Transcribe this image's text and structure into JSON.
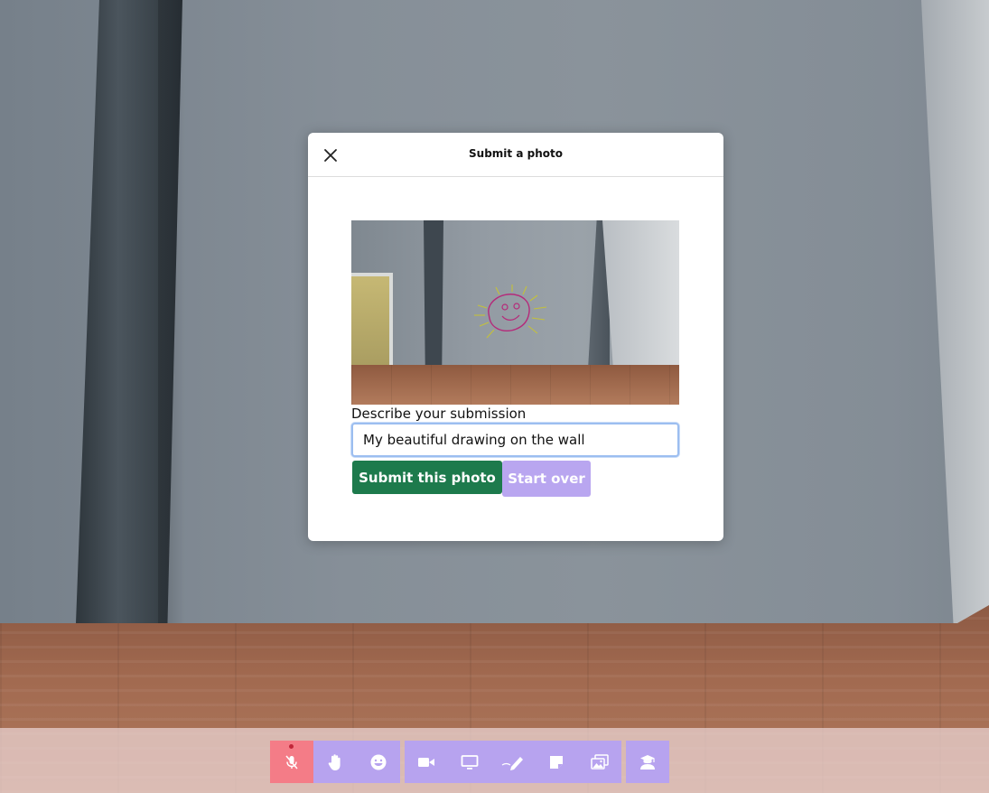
{
  "modal": {
    "title": "Submit a photo",
    "description_label": "Describe your submission",
    "description_value": "My beautiful drawing on the wall",
    "submit_label": "Submit this photo",
    "start_over_label": "Start over"
  },
  "toolbar": {
    "groups": [
      {
        "buttons": [
          "microphone-muted-icon",
          "raise-hand-icon",
          "emoji-icon"
        ]
      },
      {
        "buttons": [
          "video-camera-icon",
          "screen-share-icon",
          "draw-icon",
          "sticky-note-icon",
          "photo-gallery-icon"
        ]
      },
      {
        "buttons": [
          "teacher-icon"
        ]
      }
    ]
  },
  "colors": {
    "submit_button": "#1d7a4c",
    "start_over_button": "#b9a6f0",
    "toolbar_button": "#b7a3ef",
    "mic_button_muted": "#f47c87"
  }
}
